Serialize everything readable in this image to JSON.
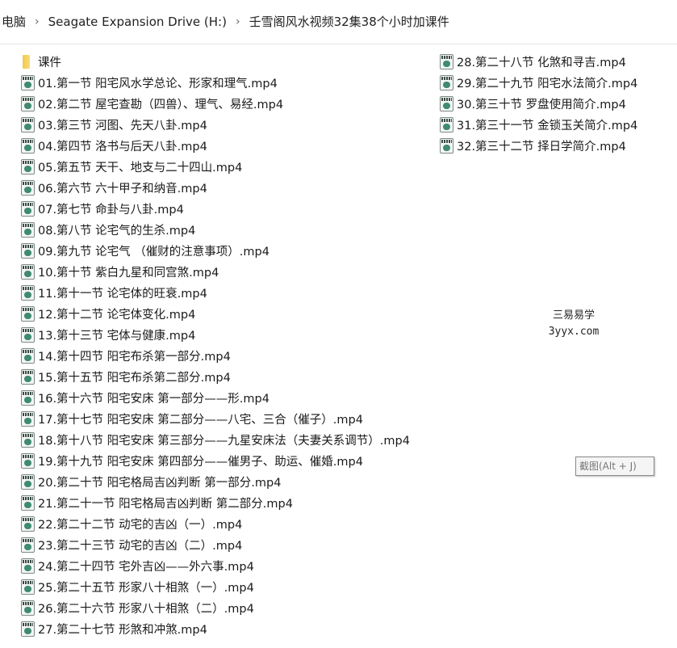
{
  "breadcrumb": [
    "电脑",
    "Seagate Expansion Drive (H:)",
    "壬雪阁风水视频32集38个小时加课件"
  ],
  "breadcrumb_separator_icon": "chevron-right-icon",
  "files_left": [
    {
      "name": "课件",
      "type": "folder"
    },
    {
      "name": "01.第一节 阳宅风水学总论、形家和理气.mp4",
      "type": "video"
    },
    {
      "name": "02.第二节 屋宅查勘（四兽）、理气、易经.mp4",
      "type": "video"
    },
    {
      "name": "03.第三节 河图、先天八卦.mp4",
      "type": "video"
    },
    {
      "name": "04.第四节 洛书与后天八卦.mp4",
      "type": "video"
    },
    {
      "name": "05.第五节 天干、地支与二十四山.mp4",
      "type": "video"
    },
    {
      "name": "06.第六节 六十甲子和纳音.mp4",
      "type": "video"
    },
    {
      "name": "07.第七节 命卦与八卦.mp4",
      "type": "video"
    },
    {
      "name": "08.第八节 论宅气的生杀.mp4",
      "type": "video"
    },
    {
      "name": "09.第九节 论宅气 （催财的注意事项）.mp4",
      "type": "video"
    },
    {
      "name": "10.第十节 紫白九星和同宫煞.mp4",
      "type": "video"
    },
    {
      "name": "11.第十一节 论宅体的旺衰.mp4",
      "type": "video"
    },
    {
      "name": "12.第十二节 论宅体变化.mp4",
      "type": "video"
    },
    {
      "name": "13.第十三节 宅体与健康.mp4",
      "type": "video"
    },
    {
      "name": "14.第十四节 阳宅布杀第一部分.mp4",
      "type": "video"
    },
    {
      "name": "15.第十五节 阳宅布杀第二部分.mp4",
      "type": "video"
    },
    {
      "name": "16.第十六节 阳宅安床 第一部分——形.mp4",
      "type": "video"
    },
    {
      "name": "17.第十七节 阳宅安床 第二部分——八宅、三合（催子）.mp4",
      "type": "video"
    },
    {
      "name": "18.第十八节 阳宅安床 第三部分——九星安床法（夫妻关系调节）.mp4",
      "type": "video"
    },
    {
      "name": "19.第十九节 阳宅安床 第四部分——催男子、助运、催婚.mp4",
      "type": "video"
    },
    {
      "name": "20.第二十节 阳宅格局吉凶判断 第一部分.mp4",
      "type": "video"
    },
    {
      "name": "21.第二十一节 阳宅格局吉凶判断 第二部分.mp4",
      "type": "video"
    },
    {
      "name": "22.第二十二节 动宅的吉凶（一）.mp4",
      "type": "video"
    },
    {
      "name": "23.第二十三节 动宅的吉凶（二）.mp4",
      "type": "video"
    },
    {
      "name": "24.第二十四节 宅外吉凶——外六事.mp4",
      "type": "video"
    },
    {
      "name": "25.第二十五节 形家八十相煞（一）.mp4",
      "type": "video"
    },
    {
      "name": "26.第二十六节 形家八十相煞（二）.mp4",
      "type": "video"
    },
    {
      "name": "27.第二十七节 形煞和冲煞.mp4",
      "type": "video"
    }
  ],
  "files_right": [
    {
      "name": "28.第二十八节 化煞和寻吉.mp4",
      "type": "video"
    },
    {
      "name": "29.第二十九节 阳宅水法简介.mp4",
      "type": "video"
    },
    {
      "name": "30.第三十节 罗盘使用简介.mp4",
      "type": "video"
    },
    {
      "name": "31.第三十一节 金锁玉关简介.mp4",
      "type": "video"
    },
    {
      "name": "32.第三十二节 择日学简介.mp4",
      "type": "video"
    }
  ],
  "watermark": {
    "line1": "三易易学",
    "line2": "3yyx.com"
  },
  "tooltip": "截图(Alt + J)",
  "colors": {
    "folder": "#f2c94c",
    "video_icon": "#3f8a72",
    "background": "#ffffff"
  }
}
